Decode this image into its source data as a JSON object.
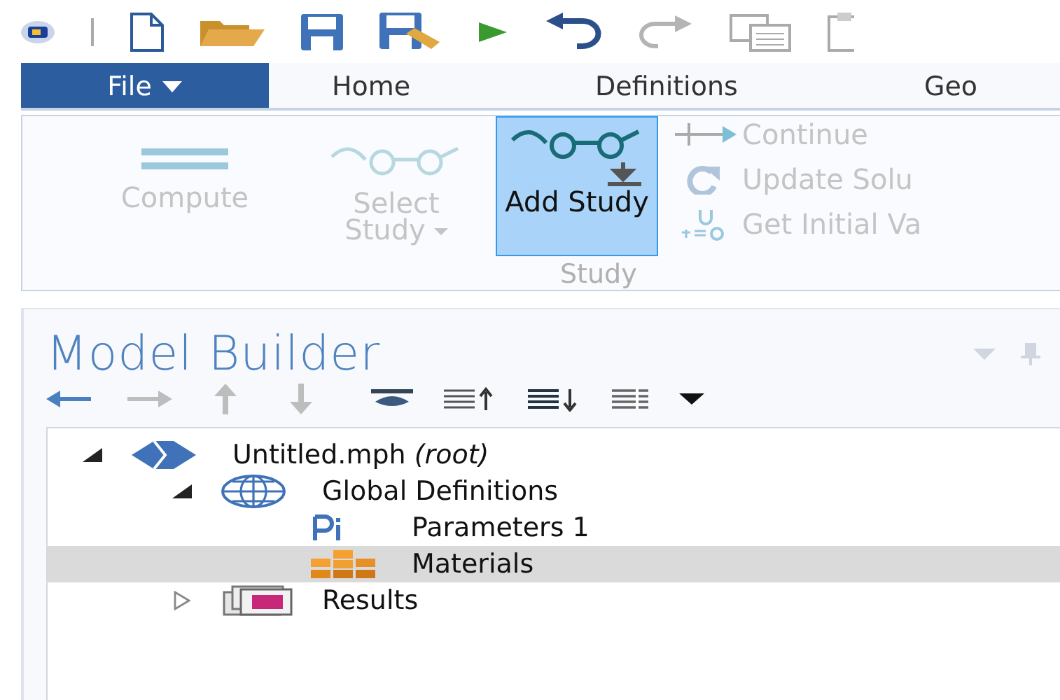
{
  "quick_access": [
    {
      "kind": "logo"
    },
    {
      "kind": "separator"
    },
    {
      "kind": "new"
    },
    {
      "kind": "open"
    },
    {
      "kind": "save"
    },
    {
      "kind": "save-as"
    },
    {
      "kind": "run"
    },
    {
      "kind": "undo"
    },
    {
      "kind": "redo"
    },
    {
      "kind": "copy"
    },
    {
      "kind": "paste"
    }
  ],
  "tabs": [
    {
      "label": "File",
      "selected": true
    },
    {
      "label": "Home",
      "selected": false
    },
    {
      "label": "Definitions",
      "selected": false
    },
    {
      "label": "Geo",
      "selected": false
    }
  ],
  "ribbon": {
    "group_label": "Study",
    "buttons": [
      {
        "kind": "large",
        "label": "Compute",
        "disabled": true,
        "selected": false
      },
      {
        "kind": "large",
        "label": "Select Study",
        "disabled": true,
        "selected": false
      },
      {
        "kind": "large",
        "label": "Add Study",
        "disabled": false,
        "selected": true
      },
      {
        "kind": "small",
        "label": "Continue",
        "disabled": true
      },
      {
        "kind": "small",
        "label": "Update Solu",
        "disabled": true
      },
      {
        "kind": "small",
        "label": "Get Initial Va",
        "disabled": true
      }
    ]
  },
  "model_builder": {
    "title": "Model Builder",
    "toolbar": [
      {
        "kind": "back",
        "disabled": false
      },
      {
        "kind": "forward",
        "disabled": true
      },
      {
        "kind": "up",
        "disabled": true
      },
      {
        "kind": "down",
        "disabled": true
      },
      {
        "kind": "eye"
      },
      {
        "kind": "collapse-all"
      },
      {
        "kind": "expand-all"
      },
      {
        "kind": "list"
      },
      {
        "kind": "menu"
      }
    ],
    "tree": [
      {
        "label": "Untitled.mph *(root)*",
        "kind": "file",
        "expanded": true,
        "selected": false,
        "children": [
          {
            "label": "Global Definitions",
            "kind": "globe",
            "expanded": true,
            "selected": false,
            "children": [
              {
                "label": "Parameters 1",
                "kind": "parameters",
                "selected": false
              },
              {
                "label": "Materials",
                "kind": "materials",
                "selected": true
              }
            ]
          },
          {
            "label": "Results",
            "kind": "results",
            "expanded": false,
            "selected": false
          }
        ]
      }
    ]
  }
}
